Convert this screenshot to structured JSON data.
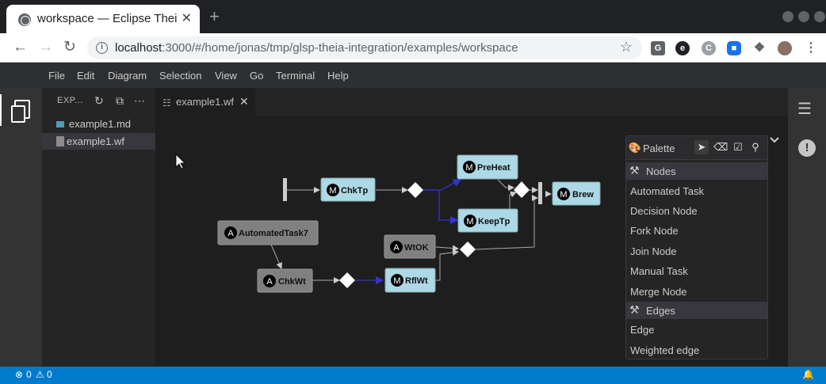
{
  "browser": {
    "tab_title": "workspace — Eclipse Theia",
    "tab_close": "✕",
    "new_tab": "+",
    "url_host": "localhost",
    "url_rest": ":3000/#/home/jonas/tmp/glsp-theia-integration/examples/workspace"
  },
  "menu": [
    "File",
    "Edit",
    "Diagram",
    "Selection",
    "View",
    "Go",
    "Terminal",
    "Help"
  ],
  "explorer": {
    "title": "EXP...",
    "files": [
      {
        "name": "example1.md"
      },
      {
        "name": "example1.wf"
      }
    ]
  },
  "editor": {
    "tab_label": "example1.wf",
    "tab_close": "✕"
  },
  "diagram": {
    "nodes": {
      "chktp": {
        "badge": "M",
        "label": "ChkTp"
      },
      "preheat": {
        "badge": "M",
        "label": "PreHeat"
      },
      "keeptp": {
        "badge": "M",
        "label": "KeepTp"
      },
      "brew": {
        "badge": "M",
        "label": "Brew"
      },
      "automatedtask7": {
        "badge": "A",
        "label": "AutomatedTask7"
      },
      "chkwt": {
        "badge": "A",
        "label": "ChkWt"
      },
      "wtok": {
        "badge": "A",
        "label": "WtOK"
      },
      "rflwt": {
        "badge": "M",
        "label": "RflWt"
      }
    },
    "colors": {
      "manual_task": "#add8e6",
      "automated_task": "#808080",
      "weighted_edge": "#3333cc",
      "edge": "#aaaaaa"
    }
  },
  "palette": {
    "title": "Palette",
    "groups": [
      {
        "label": "Nodes",
        "items": [
          "Automated Task",
          "Decision Node",
          "Fork Node",
          "Join Node",
          "Manual Task",
          "Merge Node"
        ]
      },
      {
        "label": "Edges",
        "items": [
          "Edge",
          "Weighted edge"
        ]
      }
    ]
  },
  "status": {
    "errors": "0",
    "warnings": "0"
  }
}
